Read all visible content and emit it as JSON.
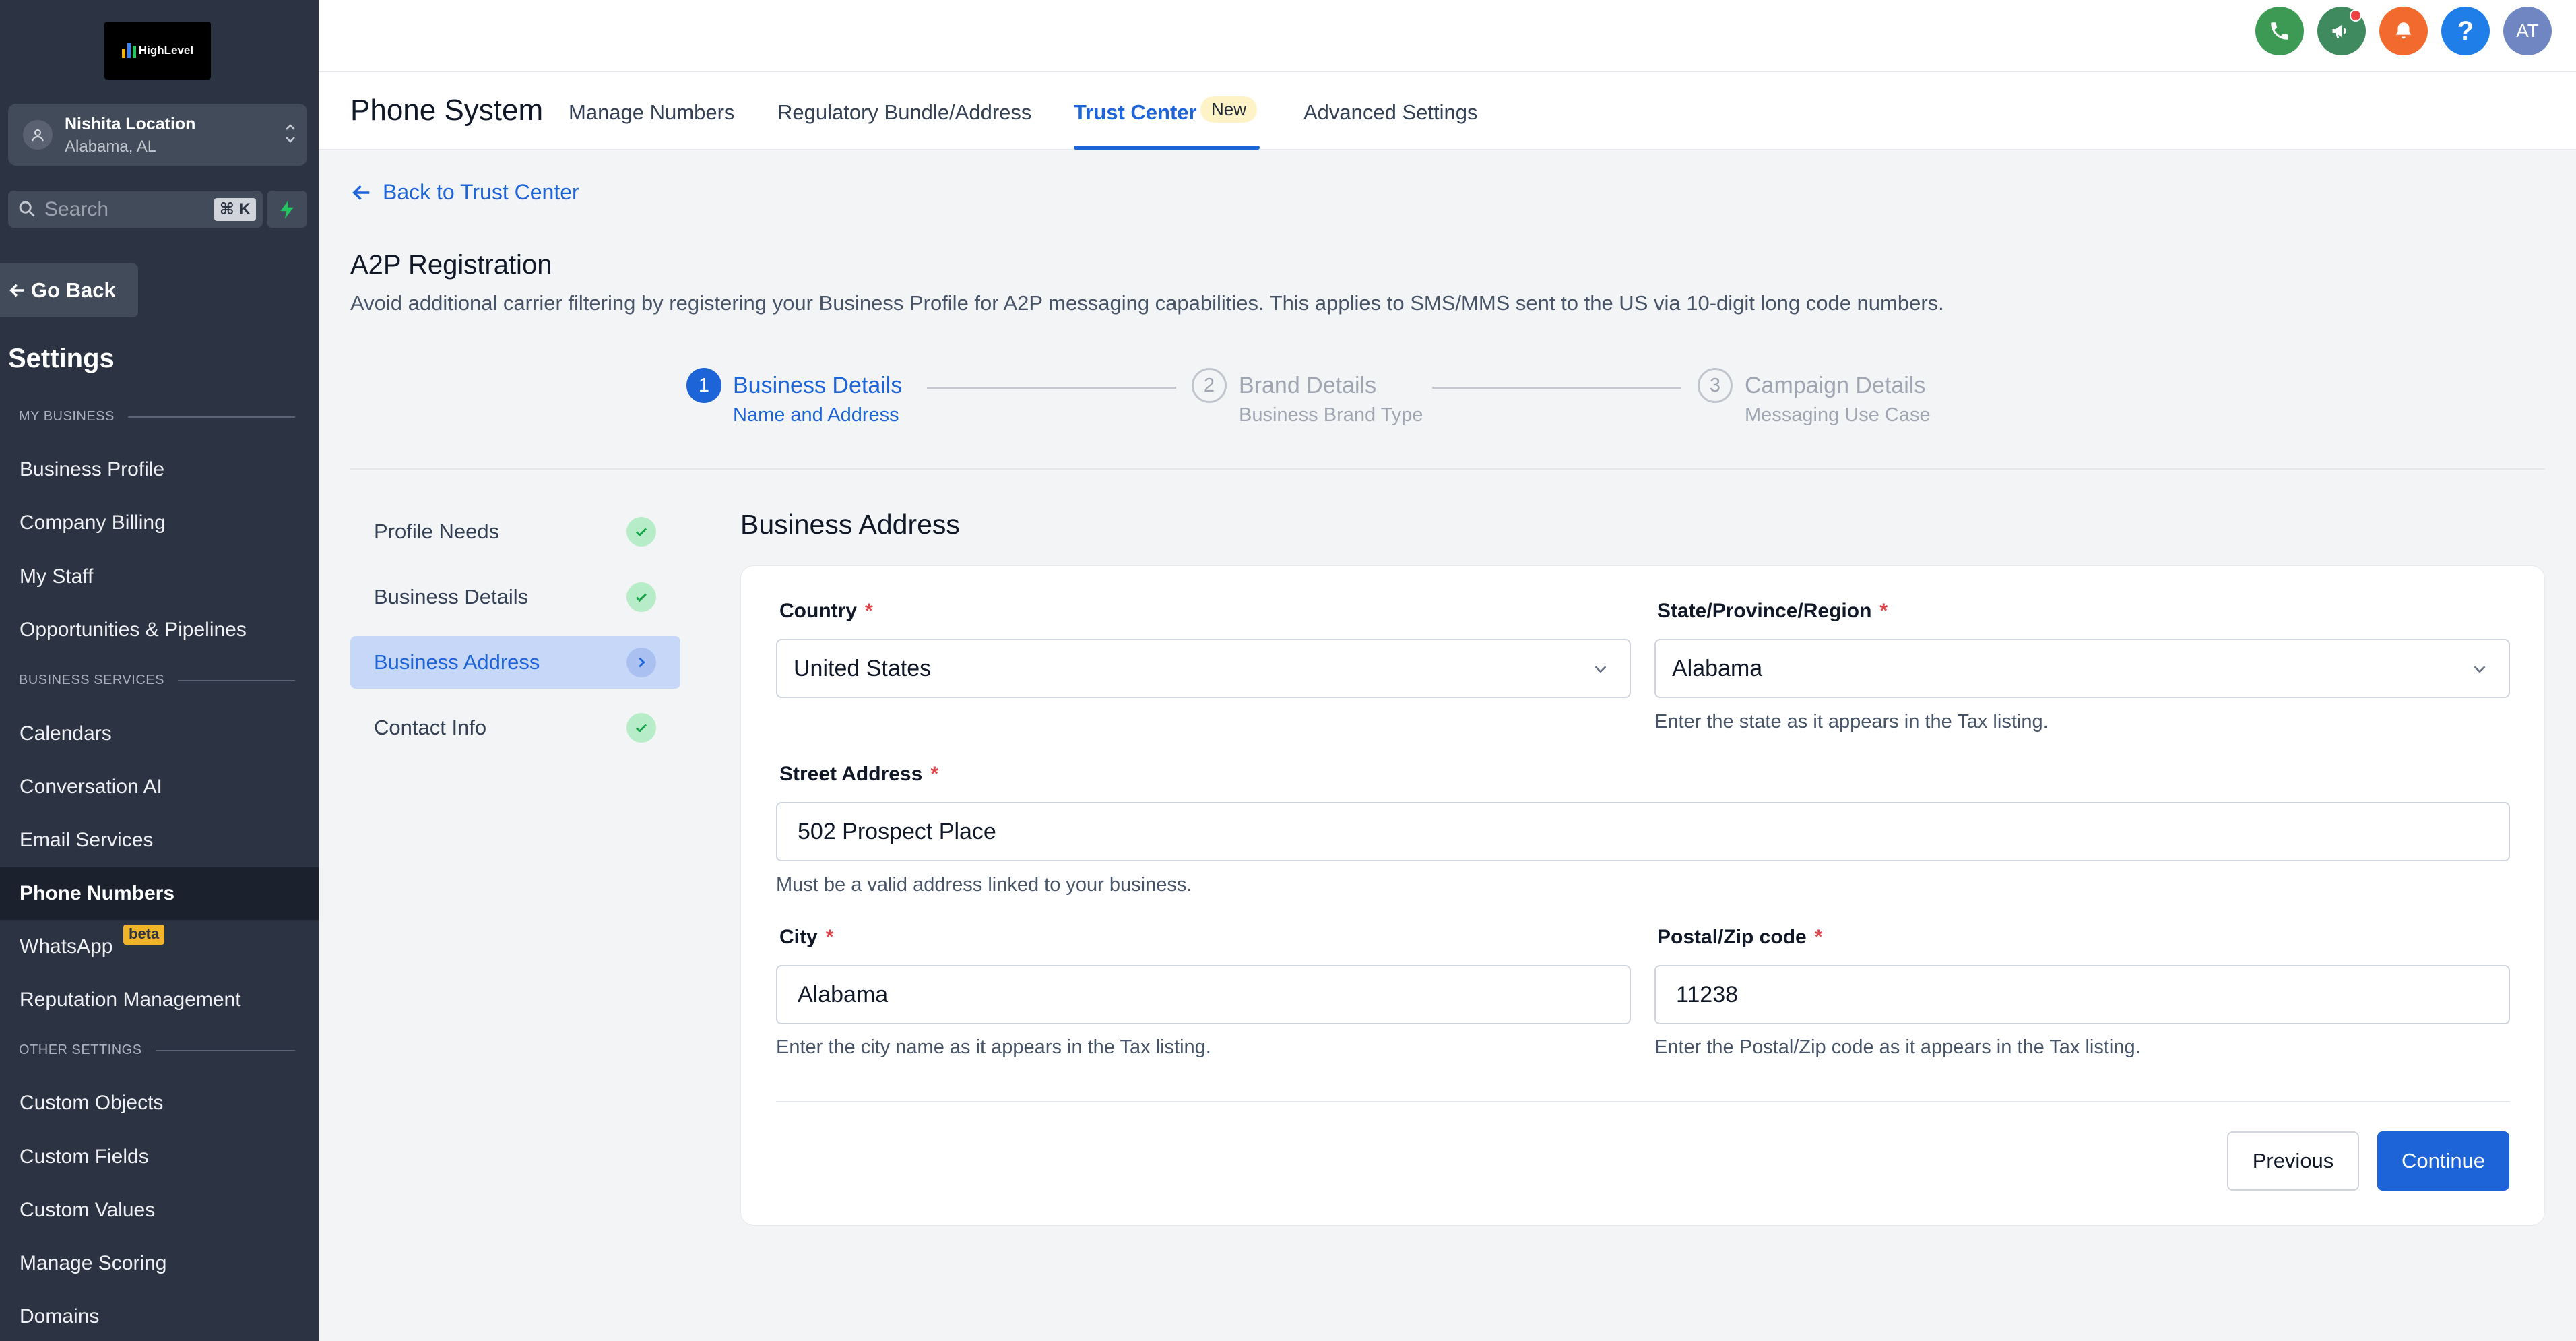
{
  "app": {
    "logo_text": "HighLevel",
    "location_name": "Nishita Location",
    "location_sub": "Alabama, AL",
    "search_placeholder": "Search",
    "search_shortcut": "⌘ K",
    "go_back": "Go Back",
    "settings_title": "Settings"
  },
  "sidebar": {
    "sections": [
      {
        "label": "MY BUSINESS",
        "items": [
          "Business Profile",
          "Company Billing",
          "My Staff",
          "Opportunities & Pipelines"
        ]
      },
      {
        "label": "BUSINESS SERVICES",
        "items": [
          "Calendars",
          "Conversation AI",
          "Email Services",
          "Phone Numbers",
          "WhatsApp",
          "Reputation Management"
        ]
      },
      {
        "label": "OTHER SETTINGS",
        "items": [
          "Custom Objects",
          "Custom Fields",
          "Custom Values",
          "Manage Scoring",
          "Domains"
        ]
      }
    ],
    "active_item": "Phone Numbers",
    "beta_label": "beta"
  },
  "topbar": {
    "icons": [
      "phone-icon",
      "megaphone-icon",
      "bell-icon",
      "help-icon",
      "avatar"
    ],
    "avatar_initials": "AT",
    "colors": {
      "phone": "#3d9a54",
      "megaphone": "#3f8a5e",
      "bell": "#f26a2e",
      "help": "#1f7ee8",
      "avatar": "#6f86c2"
    }
  },
  "subnav": {
    "page_title": "Phone System",
    "tabs": [
      "Manage Numbers",
      "Regulatory Bundle/Address",
      "Trust Center",
      "Advanced Settings"
    ],
    "active_tab": "Trust Center",
    "new_badge": "New"
  },
  "main": {
    "back_link": "Back to Trust Center",
    "title": "A2P Registration",
    "description": "Avoid additional carrier filtering by registering your Business Profile for A2P messaging capabilities. This applies to SMS/MMS sent to the US via 10-digit long code numbers.",
    "stepper": [
      {
        "num": "1",
        "title": "Business Details",
        "sub": "Name and Address",
        "state": "active"
      },
      {
        "num": "2",
        "title": "Brand Details",
        "sub": "Business Brand Type",
        "state": "pending"
      },
      {
        "num": "3",
        "title": "Campaign Details",
        "sub": "Messaging Use Case",
        "state": "pending"
      }
    ],
    "sub_steps": [
      {
        "label": "Profile Needs",
        "status": "done"
      },
      {
        "label": "Business Details",
        "status": "done"
      },
      {
        "label": "Business Address",
        "status": "current"
      },
      {
        "label": "Contact Info",
        "status": "done"
      }
    ]
  },
  "form": {
    "section_title": "Business Address",
    "country": {
      "label": "Country",
      "value": "United States"
    },
    "state": {
      "label": "State/Province/Region",
      "value": "Alabama",
      "help": "Enter the state as it appears in the Tax listing."
    },
    "street": {
      "label": "Street Address",
      "value": "502 Prospect Place",
      "help": "Must be a valid address linked to your business."
    },
    "city": {
      "label": "City",
      "value": "Alabama",
      "help": "Enter the city name as it appears in the Tax listing."
    },
    "postal": {
      "label": "Postal/Zip code",
      "value": "11238",
      "help": "Enter the Postal/Zip code as it appears in the Tax listing."
    },
    "required_mark": "*",
    "previous": "Previous",
    "continue": "Continue"
  }
}
